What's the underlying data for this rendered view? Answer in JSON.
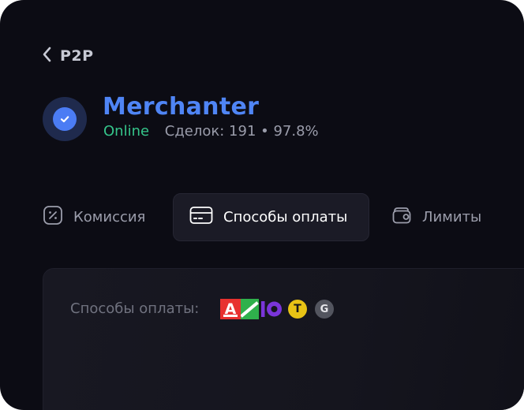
{
  "nav": {
    "back_label": "P2P"
  },
  "merchant": {
    "name": "Merchanter",
    "status": "Online",
    "stats": "Сделок: 191 • 97.8%"
  },
  "tabs": [
    {
      "label": "Комиссия",
      "icon": "percent-icon",
      "active": false
    },
    {
      "label": "Способы оплаты",
      "icon": "card-icon",
      "active": true
    },
    {
      "label": "Лимиты",
      "icon": "wallet-icon",
      "active": false
    }
  ],
  "payment_methods": {
    "label": "Способы оплаты:",
    "icons": [
      {
        "name": "alfa-bank-logo",
        "text": "A",
        "color": "#e8312f"
      },
      {
        "name": "sber-logo",
        "color": "#2fb14c"
      },
      {
        "name": "yumoney-logo",
        "text": "Ю",
        "color": "#7a35d9"
      },
      {
        "name": "tinkoff-logo",
        "text": "T",
        "color": "#e8c315"
      },
      {
        "name": "google-pay-logo",
        "text": "G",
        "color": "#53555f"
      }
    ]
  },
  "colors": {
    "background": "#0c0c14",
    "accent": "#4f85f5",
    "online": "#35c58a",
    "muted_text": "#9a9caa",
    "active_tab_bg": "#1b1b26"
  }
}
